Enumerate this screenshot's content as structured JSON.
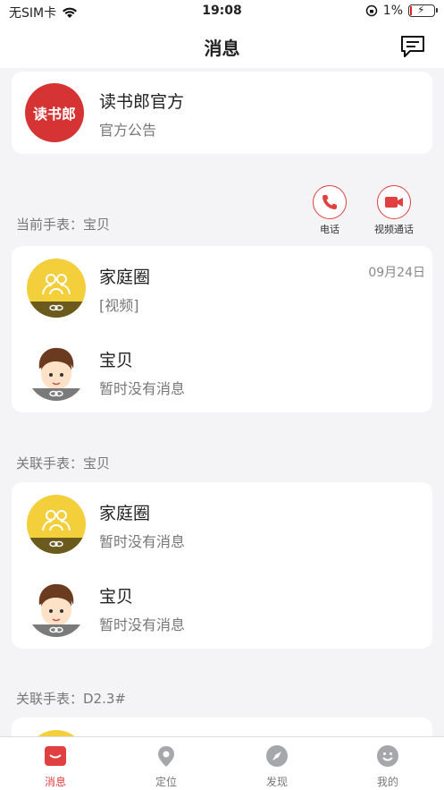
{
  "status_bar": {
    "carrier": "无SIM卡",
    "time": "19:08",
    "battery": "1%"
  },
  "header": {
    "title": "消息"
  },
  "official": {
    "logo_text": "读书郎",
    "name": "读书郎官方",
    "subtitle": "官方公告"
  },
  "current_watch": {
    "label": "当前手表：宝贝",
    "call_label": "电话",
    "video_label": "视频通话",
    "items": [
      {
        "name": "家庭圈",
        "message": "[视频]",
        "date": "09月24日"
      },
      {
        "name": "宝贝",
        "message": "暂时没有消息"
      }
    ]
  },
  "linked_watch_1": {
    "label": "关联手表：宝贝",
    "items": [
      {
        "name": "家庭圈",
        "message": "暂时没有消息"
      },
      {
        "name": "宝贝",
        "message": "暂时没有消息"
      }
    ]
  },
  "linked_watch_2": {
    "label": "关联手表：D2.3#"
  },
  "tabs": [
    {
      "label": "消息",
      "icon": "message-icon",
      "active": true
    },
    {
      "label": "定位",
      "icon": "location-icon",
      "active": false
    },
    {
      "label": "发现",
      "icon": "compass-icon",
      "active": false
    },
    {
      "label": "我的",
      "icon": "smile-icon",
      "active": false
    }
  ],
  "colors": {
    "accent": "#e04040",
    "family_yellow": "#f3cf3c",
    "family_brown": "#6b5a1e"
  }
}
